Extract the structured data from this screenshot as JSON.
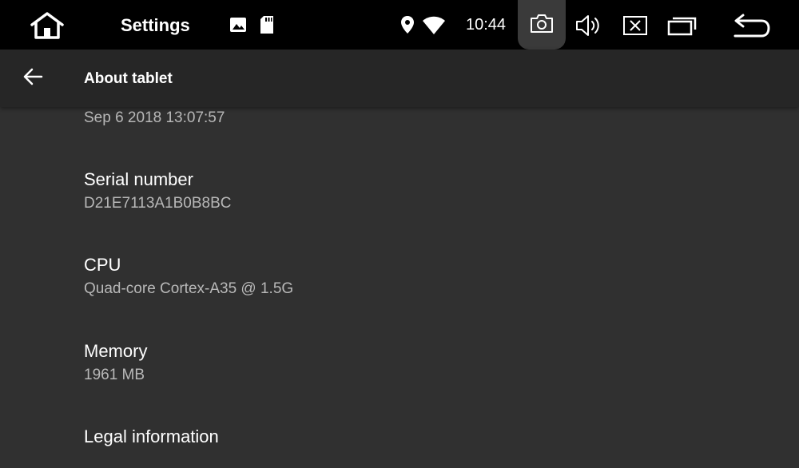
{
  "status_bar": {
    "app_title": "Settings",
    "time": "10:44",
    "icons": [
      "home-icon",
      "image-icon",
      "sd-card-icon",
      "location-icon",
      "wifi-icon",
      "camera-icon",
      "volume-icon",
      "close-window-icon",
      "recent-apps-icon",
      "back-icon"
    ]
  },
  "action_bar": {
    "title": "About tablet"
  },
  "list": {
    "partial_item": {
      "summary": "Sep  6 2018 13:07:57"
    },
    "items": [
      {
        "title": "Serial number",
        "summary": "D21E7113A1B0B8BC"
      },
      {
        "title": "CPU",
        "summary": "Quad-core Cortex-A35 @  1.5G"
      },
      {
        "title": "Memory",
        "summary": "1961 MB"
      },
      {
        "title": "Legal information",
        "summary": ""
      }
    ]
  },
  "colors": {
    "status_bar_bg": "#000000",
    "action_bar_bg": "#262626",
    "content_bg": "#303030",
    "summary_text": "#b8b8b8"
  }
}
